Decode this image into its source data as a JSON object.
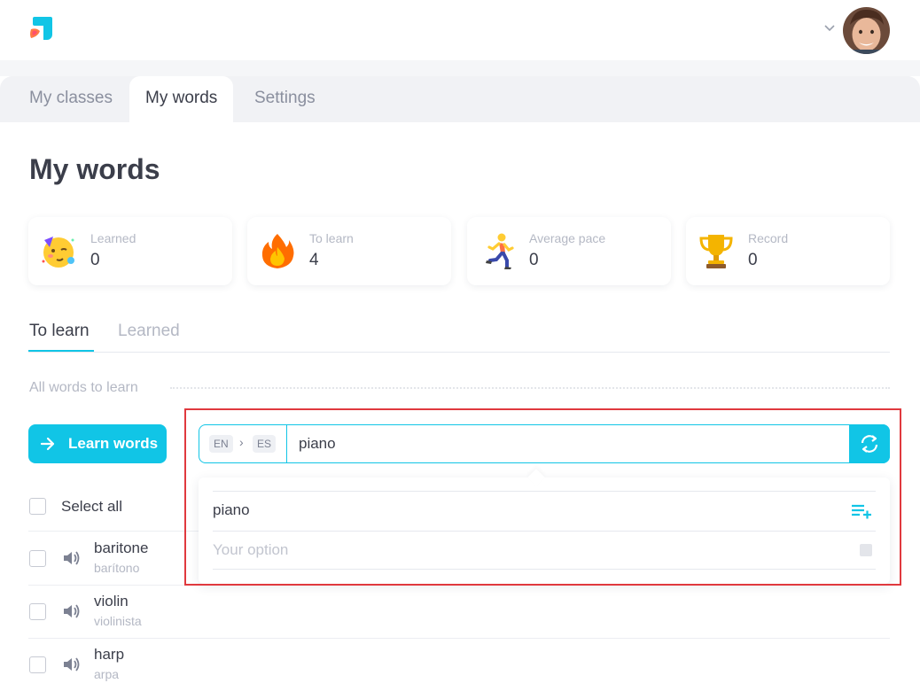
{
  "colors": {
    "accent": "#11c5e6",
    "highlight": "#e0393e"
  },
  "header": {
    "logo_icon": "app-logo-icon",
    "user_menu_icon": "chevron-down-icon"
  },
  "tabs": [
    {
      "label": "My classes",
      "active": false
    },
    {
      "label": "My words",
      "active": true
    },
    {
      "label": "Settings",
      "active": false
    }
  ],
  "page_title": "My words",
  "stats": [
    {
      "icon": "party-face-emoji",
      "label": "Learned",
      "value": "0"
    },
    {
      "icon": "fire-emoji",
      "label": "To learn",
      "value": "4"
    },
    {
      "icon": "runner-emoji",
      "label": "Average pace",
      "value": "0"
    },
    {
      "icon": "trophy-emoji",
      "label": "Record",
      "value": "0"
    }
  ],
  "subtabs": [
    {
      "label": "To learn",
      "active": true
    },
    {
      "label": "Learned",
      "active": false
    }
  ],
  "section_label": "All words to learn",
  "learn_button": "Learn words",
  "select_all": "Select all",
  "words": [
    {
      "word": "baritone",
      "translation": "barítono"
    },
    {
      "word": "violin",
      "translation": "violinista"
    },
    {
      "word": "harp",
      "translation": "arpa"
    }
  ],
  "translator": {
    "source_lang": "EN",
    "target_lang": "ES",
    "separator": "›",
    "value": "piano",
    "options": [
      {
        "text": "piano"
      }
    ],
    "custom_placeholder": "Your option"
  }
}
